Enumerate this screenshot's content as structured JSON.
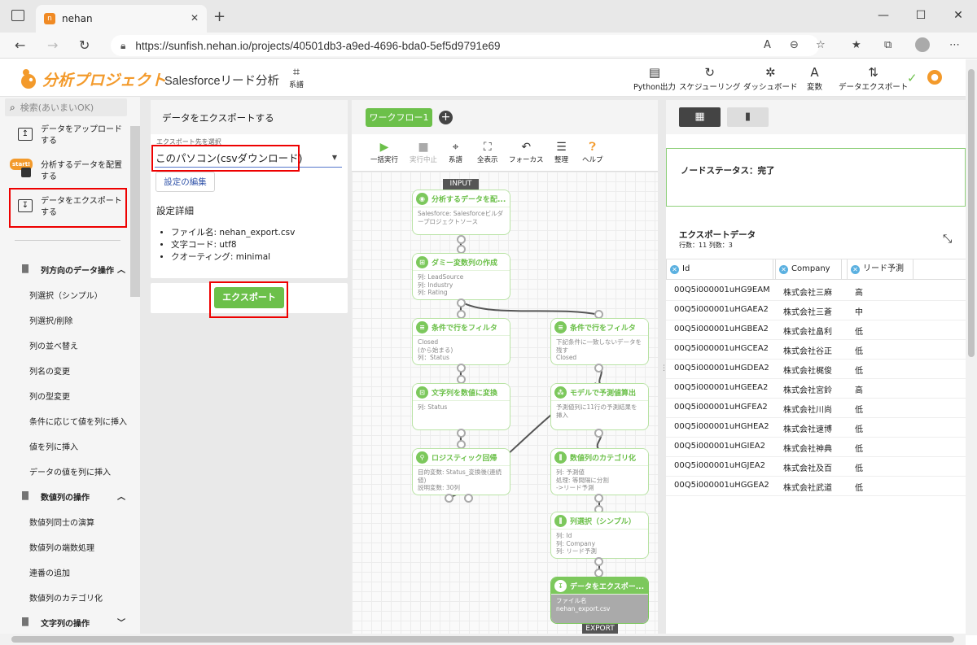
{
  "browser": {
    "tab_title": "nehan",
    "url": "https://sunfish.nehan.io/projects/40501db3-a9ed-4696-bda0-5ef5d9791e69"
  },
  "header": {
    "logo_text": "分析プロジェクト",
    "project_title": "Salesforceリード分析",
    "keifu_label": "系譜",
    "buttons": [
      {
        "label": "Python出力",
        "icon": "file-icon"
      },
      {
        "label": "スケジューリング",
        "icon": "refresh-icon"
      },
      {
        "label": "ダッシュボード",
        "icon": "tree-icon"
      },
      {
        "label": "変数",
        "icon": "variable-icon"
      },
      {
        "label": "データエクスポート",
        "icon": "updown-icon"
      }
    ]
  },
  "sidebar": {
    "search_placeholder": "検索(あいまいOK)",
    "main_items": [
      {
        "label": "データをアップロードする",
        "icon": "upload-icon"
      },
      {
        "label": "分析するデータを配置する",
        "icon": "start-icon",
        "badge": "start!"
      },
      {
        "label": "データをエクスポートする",
        "icon": "download-icon"
      }
    ],
    "sections": [
      {
        "label": "列方向のデータ操作",
        "items": [
          "列選択（シンプル）",
          "列選択/削除",
          "列の並べ替え",
          "列名の変更",
          "列の型変更",
          "条件に応じて値を列に挿入",
          "値を列に挿入",
          "データの値を列に挿入"
        ]
      },
      {
        "label": "数値列の操作",
        "items": [
          "数値列同士の演算",
          "数値列の端数処理",
          "連番の追加",
          "数値列のカテゴリ化"
        ]
      },
      {
        "label": "文字列の操作",
        "items": []
      }
    ]
  },
  "export_panel": {
    "title": "データをエクスポートする",
    "dest_label": "エクスポート先を選択",
    "dest_value": "このパソコン(csvダウンロード)",
    "edit_button": "設定の編集",
    "settings_head": "設定詳細",
    "settings": [
      "ファイル名: nehan_export.csv",
      "文字コード: utf8",
      "クオーティング: minimal"
    ],
    "export_button": "エクスポート"
  },
  "workflow": {
    "tab_label": "ワークフロー1",
    "toolbar": [
      {
        "label": "一括実行",
        "icon": "play-icon"
      },
      {
        "label": "実行中止",
        "icon": "stop-icon"
      },
      {
        "label": "系譜",
        "icon": "lineage-icon"
      },
      {
        "label": "全表示",
        "icon": "fit-icon"
      },
      {
        "label": "フォーカス",
        "icon": "focus-icon"
      },
      {
        "label": "整理",
        "icon": "arrange-icon"
      },
      {
        "label": "ヘルプ",
        "icon": "help-icon"
      }
    ],
    "input_tag": "INPUT",
    "export_tag": "EXPORT",
    "nodes": [
      {
        "title": "分析するデータを配...",
        "body": "Salesforce: Salesforceビルダープロジェクトソース"
      },
      {
        "title": "ダミー変数列の作成",
        "body": "列: LeadSource\n列: Industry\n列: Rating"
      },
      {
        "title": "条件で行をフィルタ",
        "body": "Closed\n(から始まる)\n列：Status"
      },
      {
        "title": "条件で行をフィルタ",
        "body": "下記条件に一致しないデータを残す\nClosed"
      },
      {
        "title": "文字列を数値に変換",
        "body": "列: Status"
      },
      {
        "title": "モデルで予測値算出",
        "body": "予測値列に11行の予測結果を挿入"
      },
      {
        "title": "ロジスティック回帰",
        "body": "目的変数: Status_変換後(連続値)\n説明変数: 30列"
      },
      {
        "title": "数値列のカテゴリ化",
        "body": "列: 予測値\n処理: 等間隔に分割\n->リード予測"
      },
      {
        "title": "列選択（シンプル）",
        "body": "列: Id\n列: Company\n列: リード予測"
      },
      {
        "title": "データをエクスポー...",
        "body": "ファイル名\nnehan_export.csv"
      }
    ]
  },
  "result_panel": {
    "status": "ノードステータス：完了",
    "data_title": "エクスポートデータ",
    "data_counts": "行数：11 列数：3",
    "columns": [
      "Id",
      "Company",
      "リード予測"
    ],
    "rows": [
      [
        "00Q5i000001uHG9EAM",
        "株式会社三麻",
        "高"
      ],
      [
        "00Q5i000001uHGAEA2",
        "株式会社三蒼",
        "中"
      ],
      [
        "00Q5i000001uHGBEA2",
        "株式会社畠利",
        "低"
      ],
      [
        "00Q5i000001uHGCEA2",
        "株式会社谷正",
        "低"
      ],
      [
        "00Q5i000001uHGDEA2",
        "株式会社梶俊",
        "低"
      ],
      [
        "00Q5i000001uHGEEA2",
        "株式会社宮鈴",
        "高"
      ],
      [
        "00Q5i000001uHGFEA2",
        "株式会社川尚",
        "低"
      ],
      [
        "00Q5i000001uHGHEA2",
        "株式会社速博",
        "低"
      ],
      [
        "00Q5i000001uHGIEA2",
        "株式会社神典",
        "低"
      ],
      [
        "00Q5i000001uHGJEA2",
        "株式会社及百",
        "低"
      ],
      [
        "00Q5i000001uHGGEA2",
        "株式会社武道",
        "低"
      ]
    ]
  }
}
